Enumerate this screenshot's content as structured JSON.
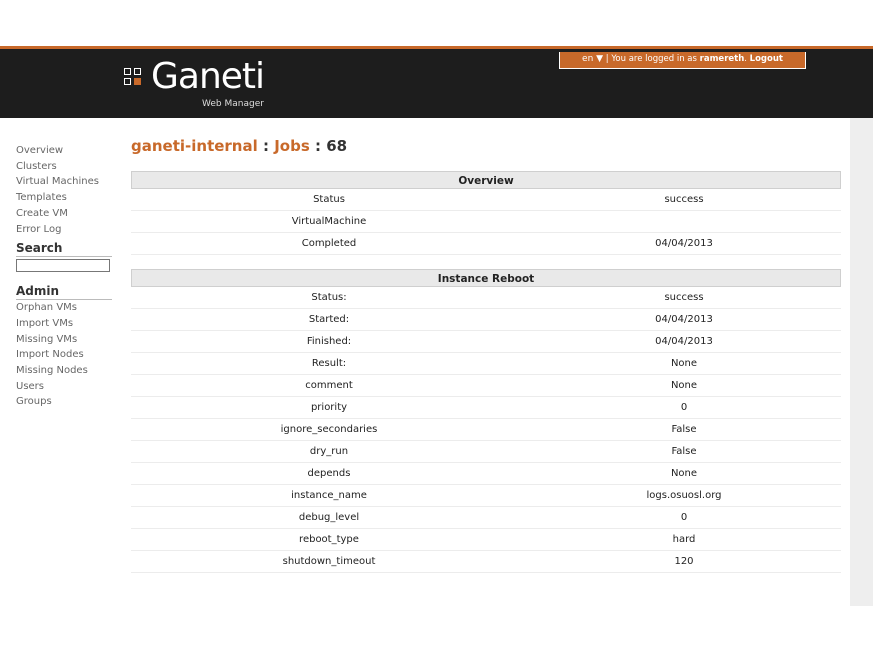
{
  "header": {
    "logo_text": "Ganeti",
    "logo_sub": "Web Manager",
    "lang": "en",
    "lang_arrow": "▼",
    "login_sep": "|",
    "login_prefix": "You are logged in as",
    "username": "ramereth",
    "logout_label": "Logout"
  },
  "sidebar": {
    "nav": [
      "Overview",
      "Clusters",
      "Virtual Machines",
      "Templates",
      "Create VM",
      "Error Log"
    ],
    "search_heading": "Search",
    "admin_heading": "Admin",
    "admin": [
      "Orphan VMs",
      "Import VMs",
      "Missing VMs",
      "Import Nodes",
      "Missing Nodes",
      "Users",
      "Groups"
    ]
  },
  "title": {
    "cluster": "ganeti-internal",
    "sep1": " : ",
    "section": "Jobs",
    "sep2": " : ",
    "job_id": "68"
  },
  "overview": {
    "heading": "Overview",
    "rows": [
      {
        "key": "Status",
        "value": "success"
      },
      {
        "key": "VirtualMachine",
        "value": ""
      },
      {
        "key": "Completed",
        "value": "04/04/2013"
      }
    ]
  },
  "reboot": {
    "heading": "Instance Reboot",
    "rows": [
      {
        "key": "Status:",
        "value": "success"
      },
      {
        "key": "Started:",
        "value": "04/04/2013"
      },
      {
        "key": "Finished:",
        "value": "04/04/2013"
      },
      {
        "key": "Result:",
        "value": "None"
      },
      {
        "key": "comment",
        "value": "None"
      },
      {
        "key": "priority",
        "value": "0"
      },
      {
        "key": "ignore_secondaries",
        "value": "False"
      },
      {
        "key": "dry_run",
        "value": "False"
      },
      {
        "key": "depends",
        "value": "None"
      },
      {
        "key": "instance_name",
        "value": "logs.osuosl.org"
      },
      {
        "key": "debug_level",
        "value": "0"
      },
      {
        "key": "reboot_type",
        "value": "hard"
      },
      {
        "key": "shutdown_timeout",
        "value": "120"
      }
    ]
  },
  "colors": {
    "accent": "#c8692a",
    "header_bg": "#1d1d1d"
  }
}
